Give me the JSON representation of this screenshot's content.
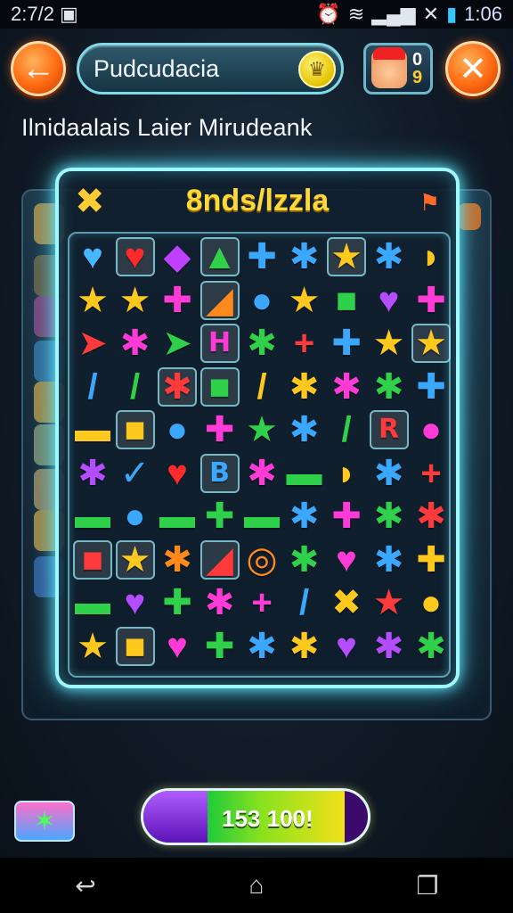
{
  "status_bar": {
    "left_text": "2:7/2",
    "left_icon": "photo-icon",
    "clock": "1:06",
    "icons": [
      "alarm-icon",
      "wifi-icon",
      "signal-icon",
      "x-data-icon",
      "battery-icon"
    ]
  },
  "header": {
    "back_icon": "back-arrow-icon",
    "title": "Pudcudacia",
    "coin_icon": "coin-icon",
    "avatar_counts": [
      "0",
      "9"
    ],
    "close_icon": "close-icon"
  },
  "subtitle": "Ilnidaalais Laier Mirudeank",
  "board": {
    "title": "8nds/lzzla",
    "left_icon": "x-badge-icon",
    "right_icon": "flag-icon"
  },
  "colors": {
    "neon_border": "#9ff7ff",
    "accent_orange": "#ff6a12",
    "title_yellow": "#ffd93b"
  },
  "pieces": [
    [
      "♥",
      "#45b8ff",
      ""
    ],
    [
      "♥",
      "#ff2a2a",
      "box"
    ],
    [
      "◆",
      "#c040ff",
      ""
    ],
    [
      "▲",
      "#2fd14a",
      "box"
    ],
    [
      "✚",
      "#3aa8ff",
      ""
    ],
    [
      "✱",
      "#3aa8ff",
      ""
    ],
    [
      "★",
      "#ffc81c",
      "box"
    ],
    [
      "✱",
      "#3aa8ff",
      ""
    ],
    [
      "◗",
      "#ffc81c",
      ""
    ],
    [
      "★",
      "#ffc81c",
      ""
    ],
    [
      "★",
      "#ffc81c",
      ""
    ],
    [
      "✚",
      "#ff3ad7",
      ""
    ],
    [
      "◢",
      "#ff8a1c",
      "box"
    ],
    [
      "●",
      "#3aa8ff",
      ""
    ],
    [
      "★",
      "#ffc81c",
      ""
    ],
    [
      "■",
      "#2fd14a",
      ""
    ],
    [
      "♥",
      "#b44dff",
      ""
    ],
    [
      "✚",
      "#ff3ad7",
      ""
    ],
    [
      "➤",
      "#ff3a3a",
      ""
    ],
    [
      "✱",
      "#ff3ad7",
      ""
    ],
    [
      "➤",
      "#2fd14a",
      ""
    ],
    [
      "H",
      "#ff3ad7",
      "box"
    ],
    [
      "✱",
      "#2fd14a",
      ""
    ],
    [
      "+",
      "#ff3a3a",
      ""
    ],
    [
      "✚",
      "#3aa8ff",
      ""
    ],
    [
      "★",
      "#ffc81c",
      ""
    ],
    [
      "★",
      "#ffc81c",
      "box"
    ],
    [
      "/",
      "#3aa8ff",
      ""
    ],
    [
      "/",
      "#2fd14a",
      ""
    ],
    [
      "✱",
      "#ff3a3a",
      "box"
    ],
    [
      "■",
      "#2fd14a",
      "box"
    ],
    [
      "/",
      "#ffc81c",
      ""
    ],
    [
      "✱",
      "#ffc81c",
      ""
    ],
    [
      "✱",
      "#ff3ad7",
      ""
    ],
    [
      "✱",
      "#2fd14a",
      ""
    ],
    [
      "✚",
      "#3aa8ff",
      ""
    ],
    [
      "▬",
      "#ffc81c",
      ""
    ],
    [
      "■",
      "#ffc81c",
      "box"
    ],
    [
      "●",
      "#3aa8ff",
      ""
    ],
    [
      "✚",
      "#ff3ad7",
      ""
    ],
    [
      "★",
      "#2fd14a",
      ""
    ],
    [
      "✱",
      "#3aa8ff",
      ""
    ],
    [
      "/",
      "#2fd14a",
      ""
    ],
    [
      "R",
      "#ff3a3a",
      "box"
    ],
    [
      "●",
      "#ff3ad7",
      ""
    ],
    [
      "✱",
      "#b44dff",
      ""
    ],
    [
      "✓",
      "#3aa8ff",
      ""
    ],
    [
      "♥",
      "#ff2a2a",
      ""
    ],
    [
      "B",
      "#3aa8ff",
      "box"
    ],
    [
      "✱",
      "#ff3ad7",
      ""
    ],
    [
      "▬",
      "#2fd14a",
      ""
    ],
    [
      "◗",
      "#ffc81c",
      ""
    ],
    [
      "✱",
      "#3aa8ff",
      ""
    ],
    [
      "+",
      "#ff3a3a",
      ""
    ],
    [
      "▬",
      "#2fd14a",
      ""
    ],
    [
      "●",
      "#3aa8ff",
      ""
    ],
    [
      "▬",
      "#2fd14a",
      ""
    ],
    [
      "✚",
      "#2fd14a",
      ""
    ],
    [
      "▬",
      "#2fd14a",
      ""
    ],
    [
      "✱",
      "#3aa8ff",
      ""
    ],
    [
      "✚",
      "#ff3ad7",
      ""
    ],
    [
      "✱",
      "#2fd14a",
      ""
    ],
    [
      "✱",
      "#ff3a3a",
      ""
    ],
    [
      "■",
      "#ff3a3a",
      "box"
    ],
    [
      "★",
      "#ffc81c",
      "box"
    ],
    [
      "✱",
      "#ff8a1c",
      ""
    ],
    [
      "◢",
      "#ff3a3a",
      "box"
    ],
    [
      "◎",
      "#ff8a1c",
      ""
    ],
    [
      "✱",
      "#2fd14a",
      ""
    ],
    [
      "♥",
      "#ff3ad7",
      ""
    ],
    [
      "✱",
      "#3aa8ff",
      ""
    ],
    [
      "✚",
      "#ffc81c",
      ""
    ],
    [
      "▬",
      "#2fd14a",
      ""
    ],
    [
      "♥",
      "#b44dff",
      ""
    ],
    [
      "✚",
      "#2fd14a",
      ""
    ],
    [
      "✱",
      "#ff3ad7",
      ""
    ],
    [
      "+",
      "#ff3ad7",
      ""
    ],
    [
      "/",
      "#3aa8ff",
      ""
    ],
    [
      "✖",
      "#ffc81c",
      ""
    ],
    [
      "★",
      "#ff3a3a",
      ""
    ],
    [
      "●",
      "#ffc81c",
      ""
    ],
    [
      "★",
      "#ffc81c",
      ""
    ],
    [
      "■",
      "#ffc81c",
      "box"
    ],
    [
      "♥",
      "#ff3ad7",
      ""
    ],
    [
      "✚",
      "#2fd14a",
      ""
    ],
    [
      "✱",
      "#3aa8ff",
      ""
    ],
    [
      "✱",
      "#ffc81c",
      ""
    ],
    [
      "♥",
      "#b44dff",
      ""
    ],
    [
      "✱",
      "#b44dff",
      ""
    ],
    [
      "✱",
      "#2fd14a",
      ""
    ]
  ],
  "footer": {
    "badge_icon": "lightning-icon",
    "progress_text": "153 100!",
    "progress_level": 0.72
  },
  "nav": [
    "back-nav-icon",
    "home-nav-icon",
    "recents-nav-icon"
  ]
}
